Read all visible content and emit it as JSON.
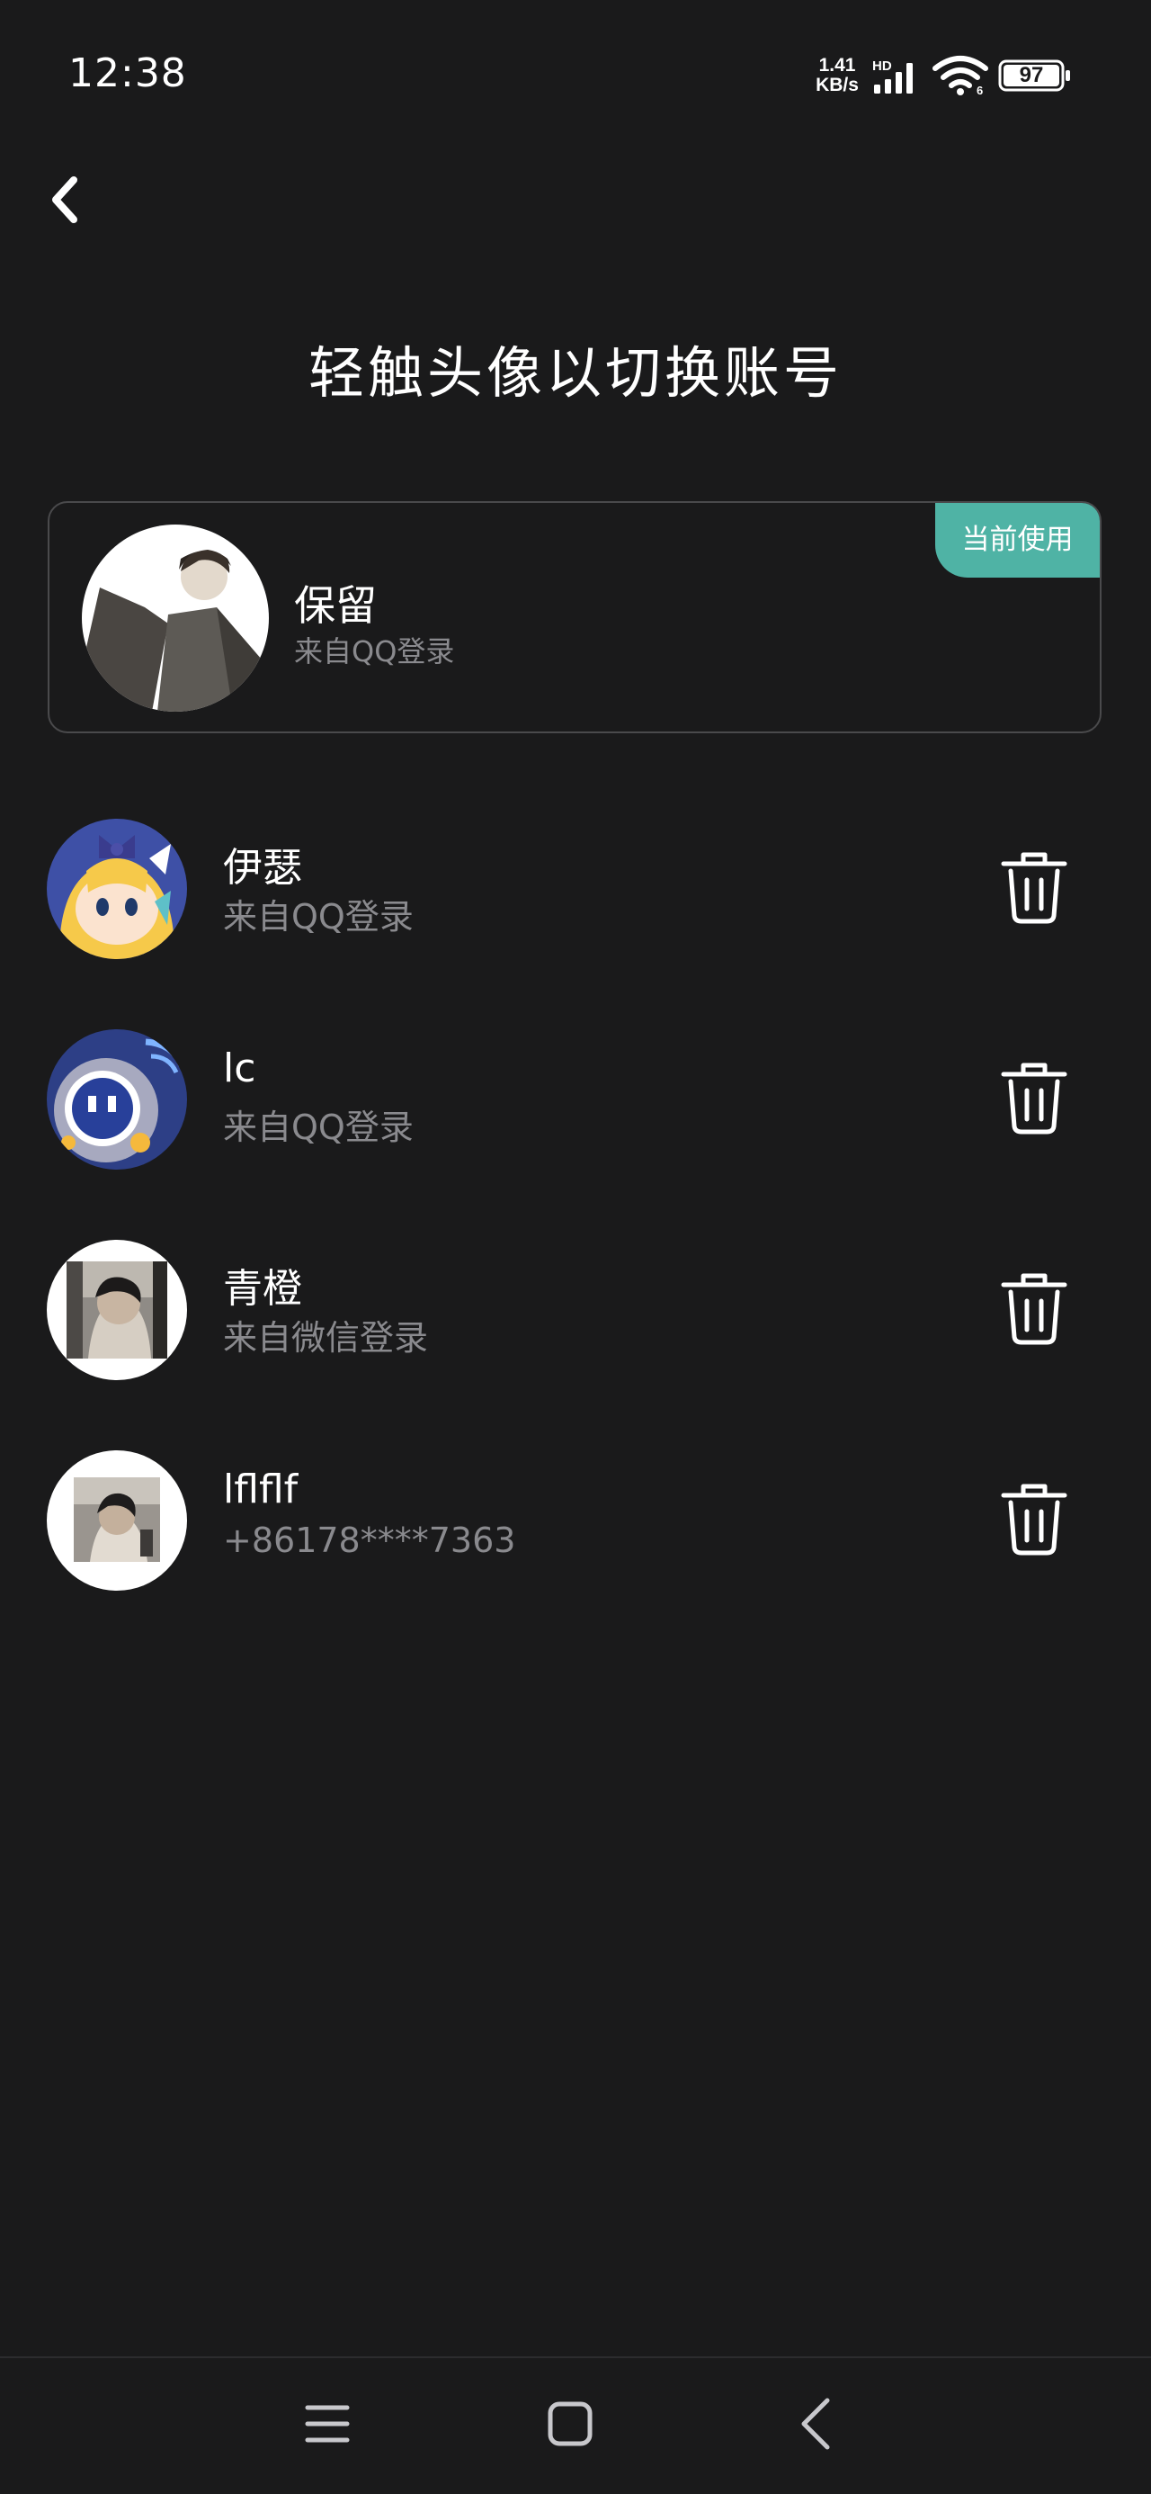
{
  "status_bar": {
    "time": "12:38",
    "net_speed_value": "1.41",
    "net_speed_unit": "KB/s",
    "network_label": "HD",
    "battery": "97",
    "icons": [
      "hd-signal-icon",
      "wifi-icon",
      "battery-icon"
    ]
  },
  "header": {
    "back_icon": "chevron-left-icon",
    "title": "轻触头像以切换账号"
  },
  "current_account": {
    "badge": "当前使用",
    "name": "保留",
    "source": "来自QQ登录"
  },
  "accounts": [
    {
      "name": "伊瑟",
      "source": "来自QQ登录",
      "action_icon": "trash-icon"
    },
    {
      "name": "lc",
      "source": "来自QQ登录",
      "action_icon": "trash-icon"
    },
    {
      "name": "青橙",
      "source": "来自微信登录",
      "action_icon": "trash-icon"
    },
    {
      "name": "lflflf",
      "source": "+86178****7363",
      "action_icon": "trash-icon"
    }
  ],
  "nav_bar": {
    "icons": [
      "menu-icon",
      "home-square-icon",
      "back-chevron-icon"
    ]
  },
  "colors": {
    "background": "#1a1a1b",
    "badge": "#4fb3a5",
    "secondary_text": "#8a8a8e",
    "card_border": "#4a4a4c"
  }
}
